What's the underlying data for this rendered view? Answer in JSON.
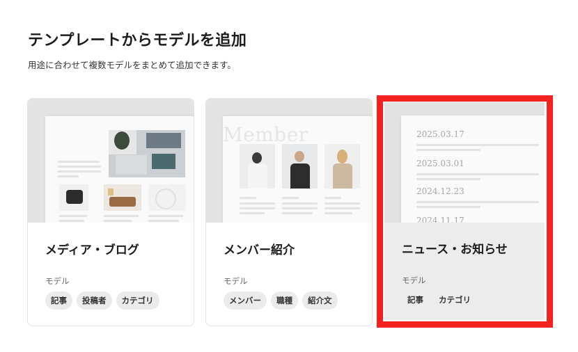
{
  "dialog": {
    "title": "テンプレートからモデルを追加",
    "subtitle": "用途に合わせて複数モデルをまとめて追加できます。"
  },
  "cards": [
    {
      "name": "メディア・ブログ",
      "model_label": "モデル",
      "tags": [
        "記事",
        "投稿者",
        "カテゴリ"
      ]
    },
    {
      "name": "メンバー紹介",
      "model_label": "モデル",
      "tags": [
        "メンバー",
        "職種",
        "紹介文"
      ],
      "preview_heading": "Member"
    },
    {
      "name": "ニュース・お知らせ",
      "model_label": "モデル",
      "tags": [
        "記事",
        "カテゴリ"
      ],
      "preview_dates": [
        "2025.03.17",
        "2025.03.01",
        "2024.12.23",
        "2024.11.17"
      ],
      "selected": true
    }
  ],
  "colors": {
    "highlight": "#f3221e",
    "tag_bg": "#ebebeb"
  }
}
